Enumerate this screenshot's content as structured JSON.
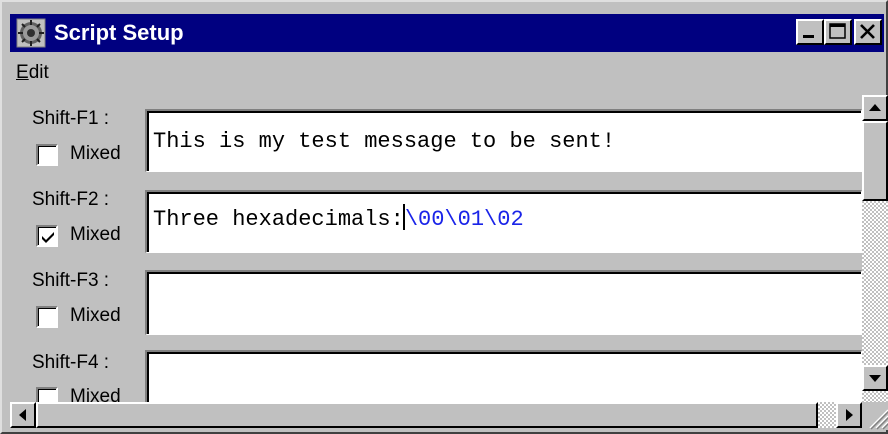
{
  "window": {
    "title": "Script Setup",
    "icon": "app-gear-icon"
  },
  "menu": {
    "edit_underlined": "E",
    "edit_rest": "dit"
  },
  "rows": [
    {
      "label": "Shift-F1 :",
      "mixed_label": "Mixed",
      "mixed_checked": false,
      "text": "This is my test message to be sent!",
      "hex": ""
    },
    {
      "label": "Shift-F2 :",
      "mixed_label": "Mixed",
      "mixed_checked": true,
      "text": "Three hexadecimals:",
      "hex": "\\00\\01\\02"
    },
    {
      "label": "Shift-F3 :",
      "mixed_label": "Mixed",
      "mixed_checked": false,
      "text": "",
      "hex": ""
    },
    {
      "label": "Shift-F4 :",
      "mixed_label": "Mixed",
      "mixed_checked": false,
      "text": "",
      "hex": ""
    }
  ],
  "colors": {
    "titlebar": "#000080",
    "hex_text": "#1a24e8",
    "face": "#c0c0c0"
  }
}
